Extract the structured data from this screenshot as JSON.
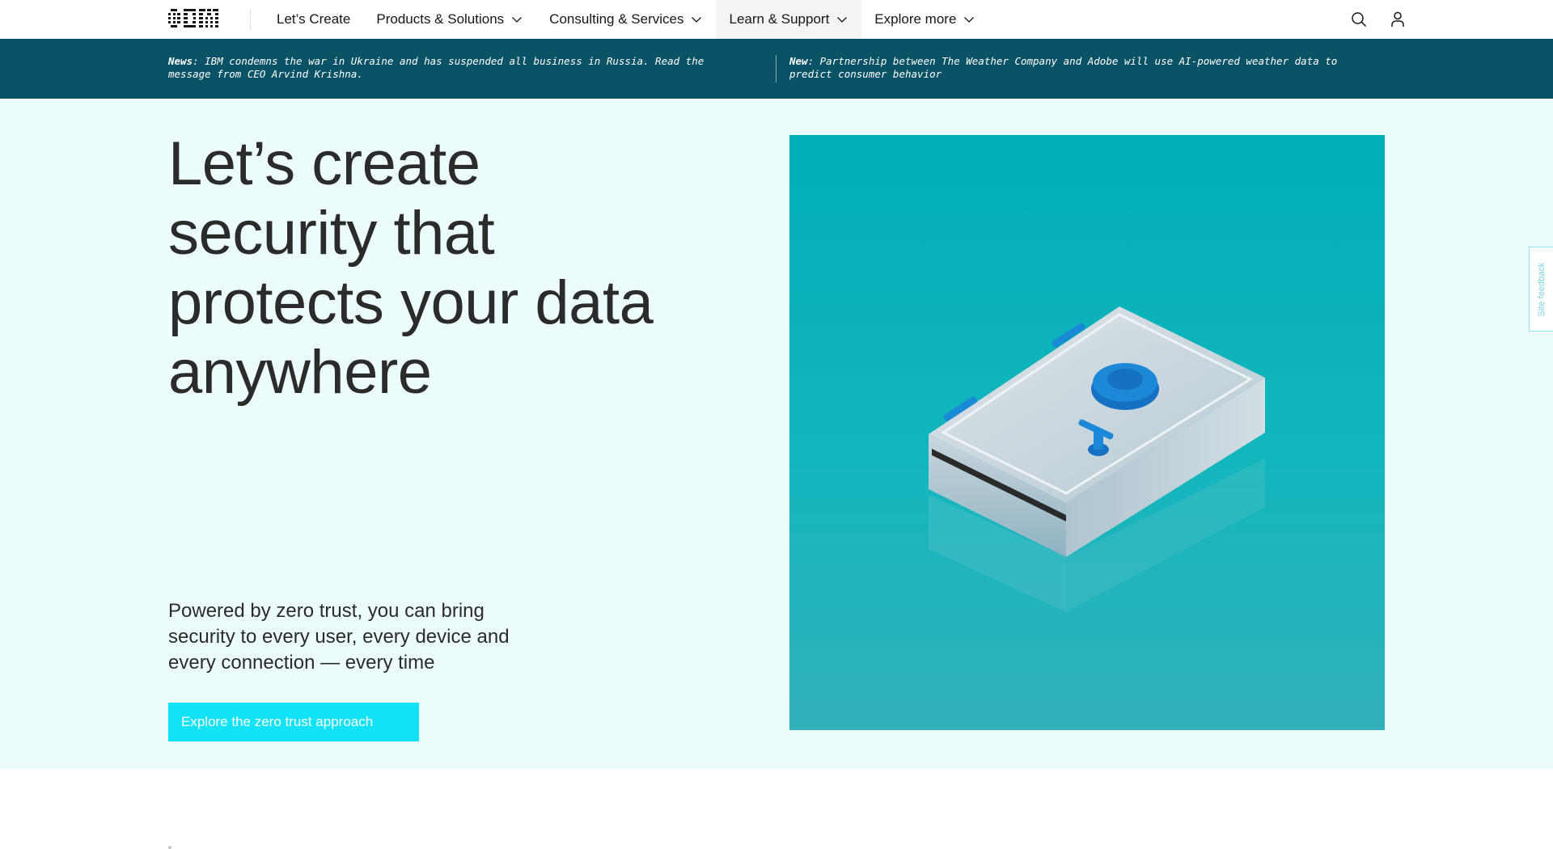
{
  "masthead": {
    "logo_text": "IBM",
    "nav": [
      {
        "label": "Let’s Create",
        "has_dropdown": false,
        "active": false
      },
      {
        "label": "Products & Solutions",
        "has_dropdown": true,
        "active": false
      },
      {
        "label": "Consulting & Services",
        "has_dropdown": true,
        "active": false
      },
      {
        "label": "Learn & Support",
        "has_dropdown": true,
        "active": true
      },
      {
        "label": "Explore more",
        "has_dropdown": true,
        "active": false
      }
    ],
    "icons": [
      "search-icon",
      "user-icon"
    ]
  },
  "news_strip": {
    "items": [
      {
        "tag": "News",
        "text": ": IBM condemns the war in Ukraine and has suspended all business in Russia. Read the message from CEO Arvind Krishna."
      },
      {
        "tag": "New",
        "text": ": Partnership between The Weather Company and Adobe will use AI-powered weather data to predict consumer behavior"
      }
    ]
  },
  "hero": {
    "headline": "Let’s create security that protects your data anywhere",
    "subcopy": "Powered by zero trust, you can bring security to every user, every device and every connection — every time",
    "cta_label": "Explore the zero trust approach"
  },
  "feedback_tab": {
    "label": "Site feedback"
  },
  "colors": {
    "news_bg": "#0a5266",
    "hero_bg": "#ecfcfd",
    "cta_bg": "#12e2f7",
    "image_bg": "#04b4bc",
    "text": "#2b2b2b"
  }
}
